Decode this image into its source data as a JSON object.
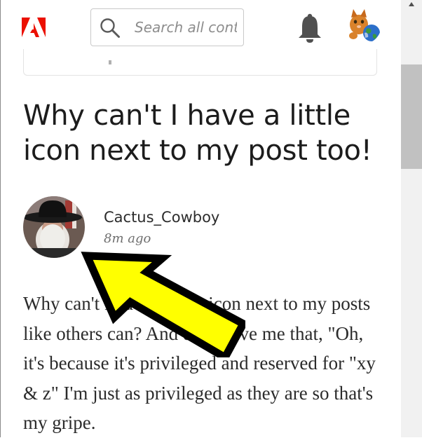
{
  "header": {
    "logo_text": "Adobe",
    "search": {
      "placeholder": "Search all content"
    },
    "notifications_icon": "bell-icon",
    "user_avatar_icon": "kitten-avatar"
  },
  "post": {
    "title": "Why can't I have a little icon next to my post too!",
    "author": "Cactus_Cowboy",
    "time": "8m ago",
    "body": "Why can't I have a little icon next to my posts like others can? And don't give me that, \"Oh, it's because it's privileged and reserved for \"xy & z\" I'm just as privileged as they are so that's my gripe."
  },
  "annotation": {
    "arrow_color": "#ffff00",
    "outline_color": "#000000"
  },
  "colors": {
    "brand_red": "#eb1000",
    "title_text": "#1c1c1c",
    "body_text": "#2b2b2b"
  }
}
